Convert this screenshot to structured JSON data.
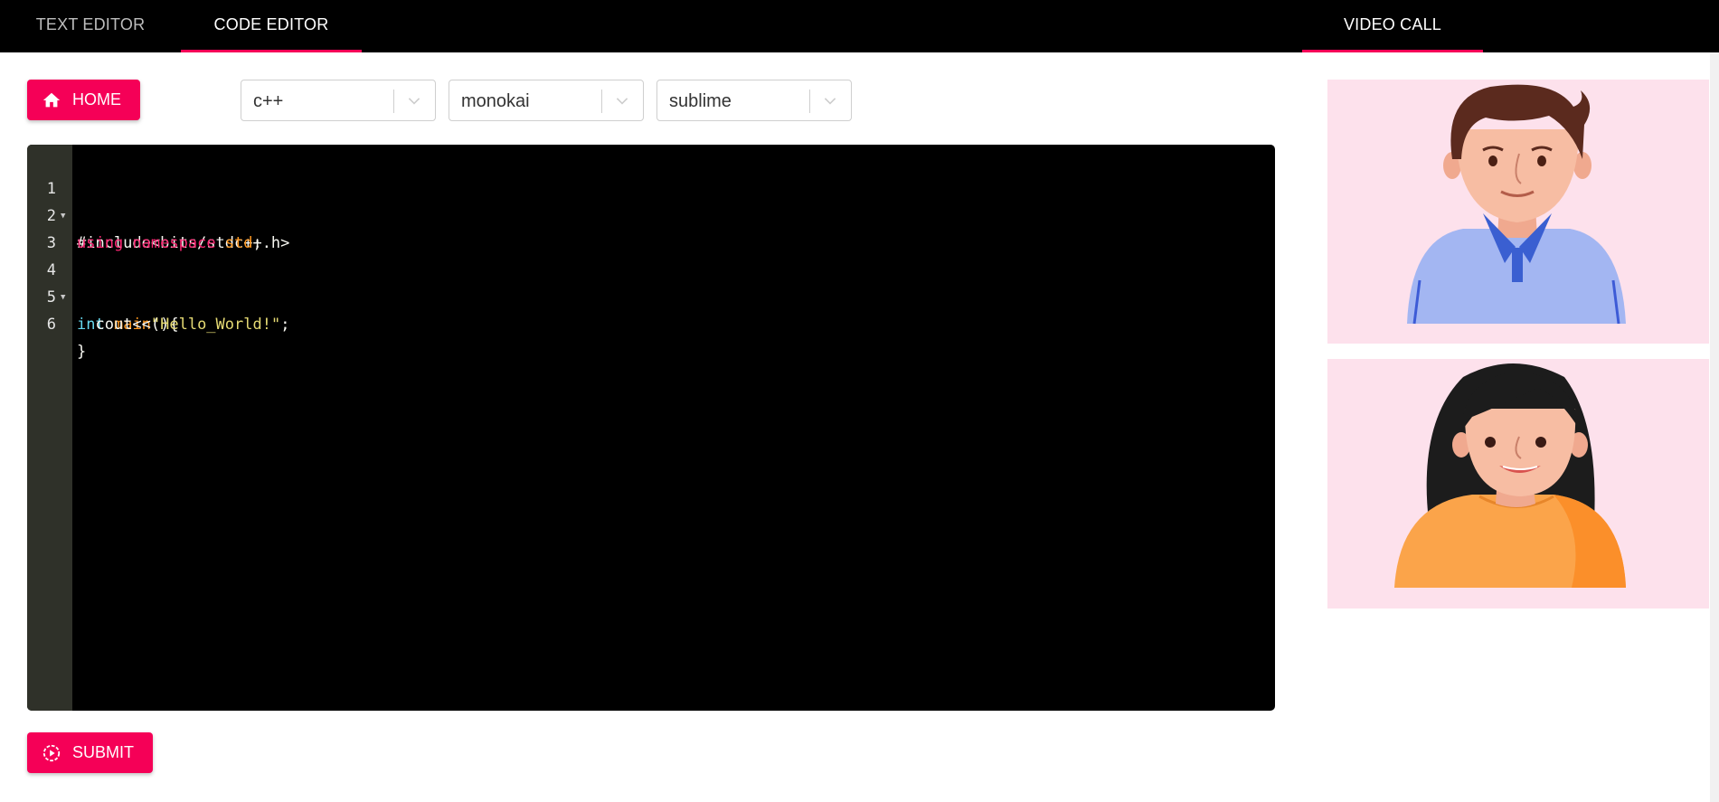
{
  "nav": {
    "tabs": [
      {
        "label": "TEXT EDITOR",
        "active": false
      },
      {
        "label": "CODE EDITOR",
        "active": true
      },
      {
        "label": "VIDEO CALL",
        "active": true
      }
    ],
    "accent_color": "#f50057"
  },
  "toolbar": {
    "home_label": "HOME",
    "home_icon": "home-icon",
    "language": "c++",
    "theme": "monokai",
    "keybinding": "sublime"
  },
  "editor": {
    "lines": [
      {
        "num": "1",
        "fold": true
      },
      {
        "num": "2",
        "fold": false
      },
      {
        "num": "3",
        "fold": false
      },
      {
        "num": "4",
        "fold": true
      },
      {
        "num": "5",
        "fold": false
      },
      {
        "num": "6",
        "fold": false
      }
    ],
    "tokens": {
      "l1": "#include<bits/stdc++.h>",
      "l2_using": "using",
      "l2_namespace": "namespace",
      "l2_std": "std",
      "l2_semi": ";",
      "l4_int": "int",
      "l4_main": "main",
      "l4_rest": "(){",
      "l5_cout": "  cout<<",
      "l5_str": "\"Hello_World!\"",
      "l5_semi": ";",
      "l6": "}"
    }
  },
  "actions": {
    "submit_label": "SUBMIT",
    "submit_icon": "play-circle-icon"
  },
  "video": {
    "participants": [
      {
        "icon": "male-avatar-icon"
      },
      {
        "icon": "female-avatar-icon"
      }
    ]
  }
}
